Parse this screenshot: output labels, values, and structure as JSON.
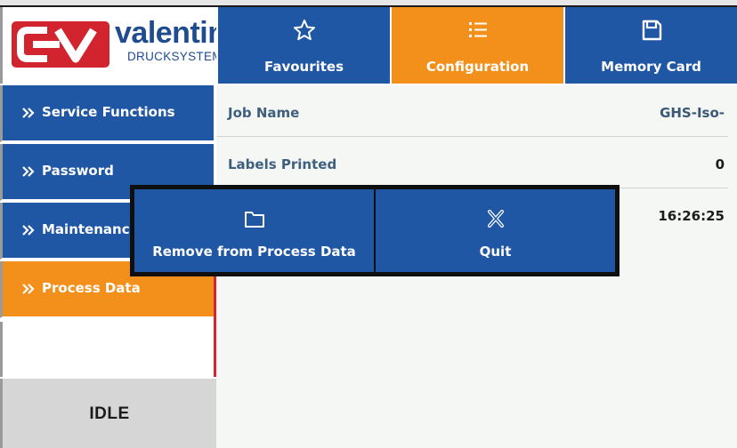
{
  "brand": {
    "name": "valentin",
    "subtitle": "DRUCKSYSTEME",
    "logo_mark_text": "CV",
    "colors": {
      "red": "#d2242f",
      "blue": "#1f4b8f"
    }
  },
  "tabs": [
    {
      "label": "Favourites",
      "icon": "star-icon",
      "active": false
    },
    {
      "label": "Configuration",
      "icon": "list-icon",
      "active": true
    },
    {
      "label": "Memory Card",
      "icon": "floppy-disk-icon",
      "active": false
    }
  ],
  "sidebar": {
    "items": [
      {
        "label": "Service Functions",
        "active": false
      },
      {
        "label": "Password",
        "active": false
      },
      {
        "label": "Maintenance",
        "active": false
      },
      {
        "label": "Process Data",
        "active": true
      }
    ]
  },
  "status": {
    "text": "IDLE"
  },
  "content": {
    "rows": [
      {
        "label": "Job Name",
        "value": "GHS-Iso-"
      },
      {
        "label": "Labels Printed",
        "value": "0"
      },
      {
        "label": "",
        "value": "16:26:25"
      }
    ]
  },
  "modal": {
    "buttons": [
      {
        "label": "Remove from Process Data",
        "icon": "folder-icon"
      },
      {
        "label": "Quit",
        "icon": "close-icon"
      }
    ]
  },
  "colors": {
    "primary": "#1f57a5",
    "accent": "#f3901c",
    "content_bg": "#f4f7f4",
    "status_bg": "#d6d6d6",
    "modal_border": "#0f0f0f"
  }
}
